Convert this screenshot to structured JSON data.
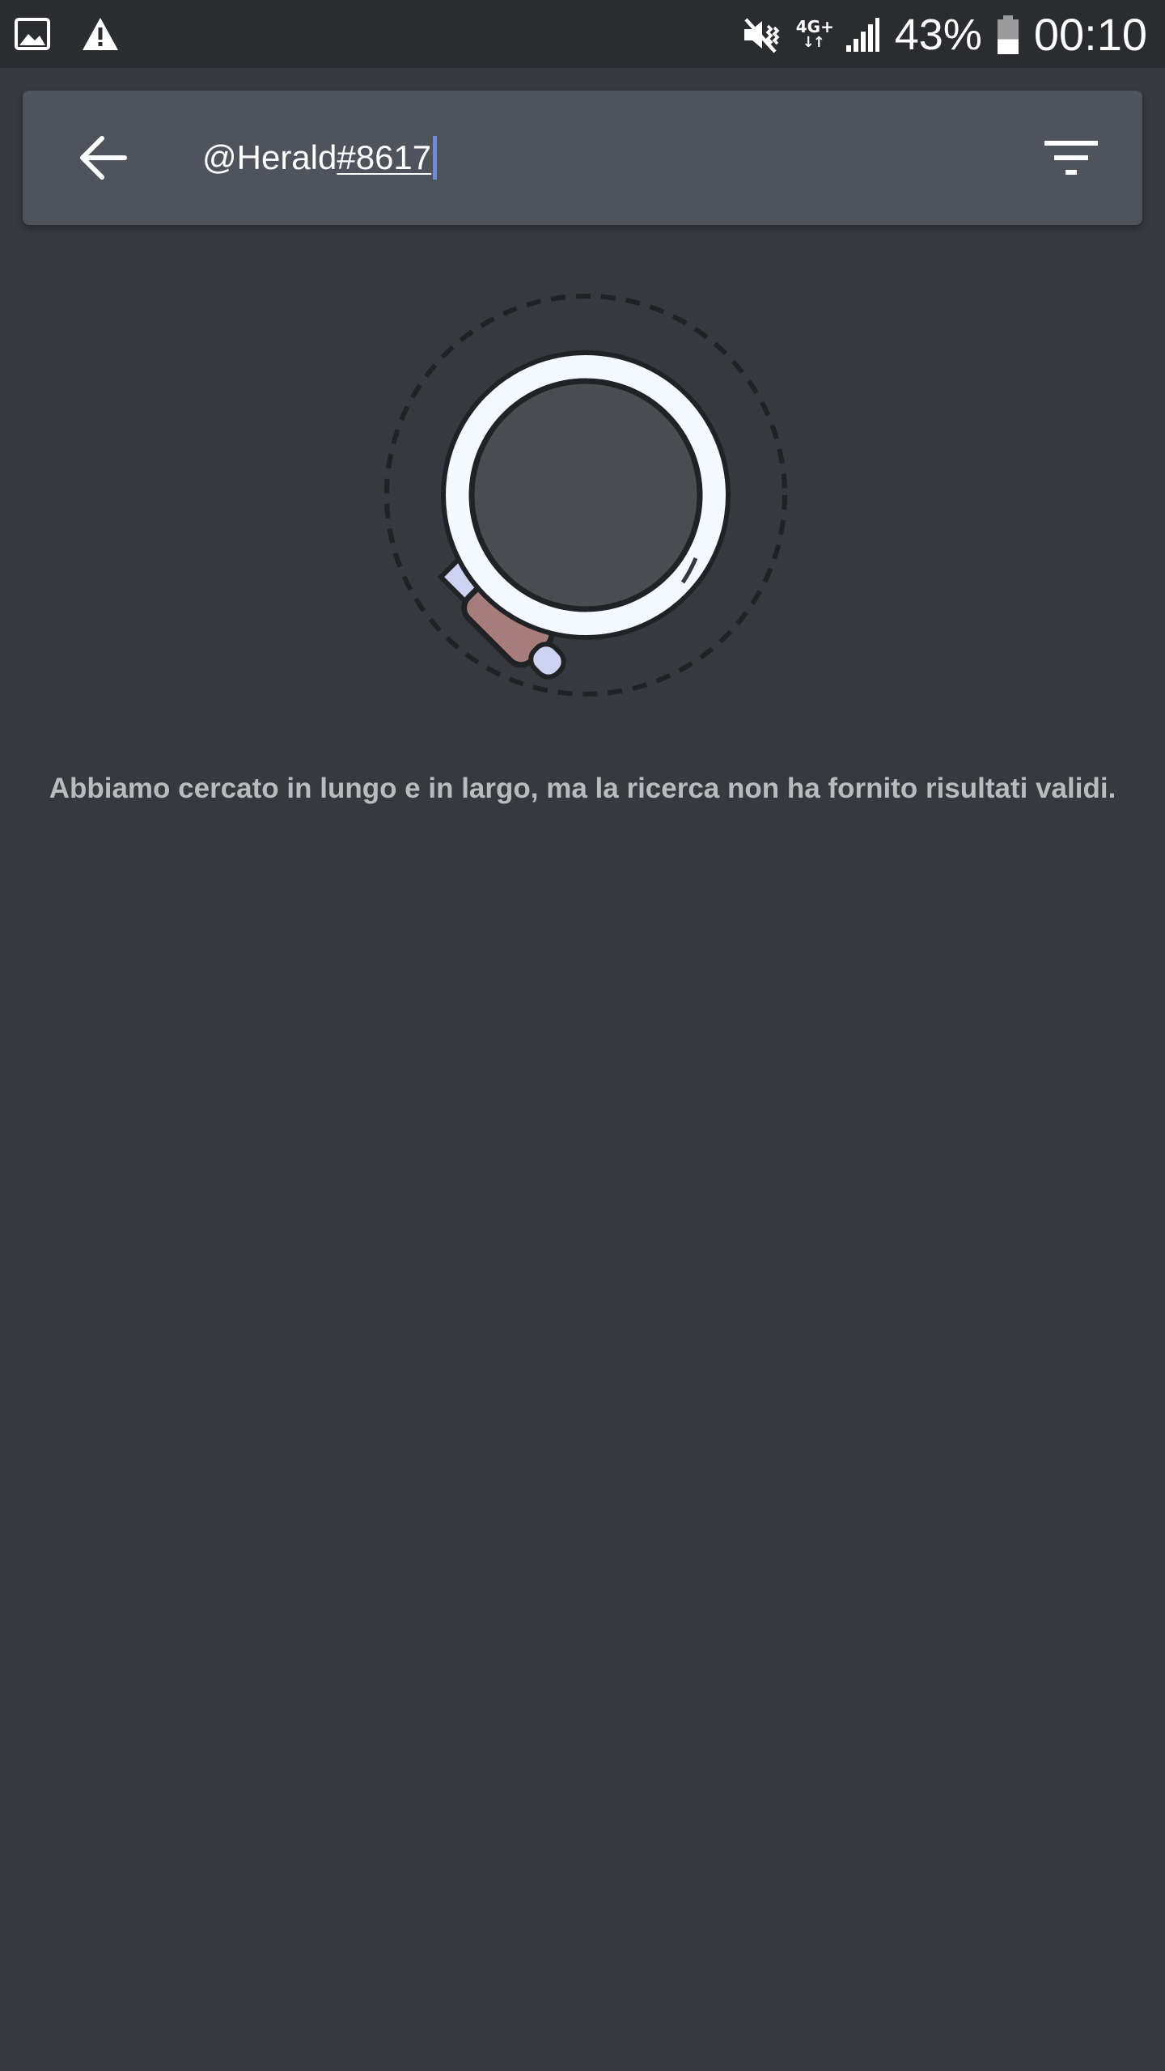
{
  "status_bar": {
    "left_icons": [
      "image-icon",
      "warning-icon"
    ],
    "right_icons": [
      "vibrate-mute-icon",
      "network-type-icon",
      "signal-icon",
      "battery-icon"
    ],
    "network_type": "4G+",
    "battery_percent": "43%",
    "battery_level": 0.43,
    "time": "00:10"
  },
  "search": {
    "back_icon": "arrow-left-icon",
    "query_prefix": "@Herald",
    "query_tag": "#8617",
    "filter_icon": "filter-icon"
  },
  "empty_state": {
    "illustration": "magnifying-glass-icon",
    "message": "Abbiamo cercato in lungo e in largo, ma la ricerca non ha fornito risultati validi."
  },
  "colors": {
    "background": "#36393f",
    "status_bar": "#2a2c30",
    "search_bar": "#4f545c",
    "caret": "#7289da",
    "text_muted": "#b9bbbe",
    "handle": "#a67d7b"
  }
}
